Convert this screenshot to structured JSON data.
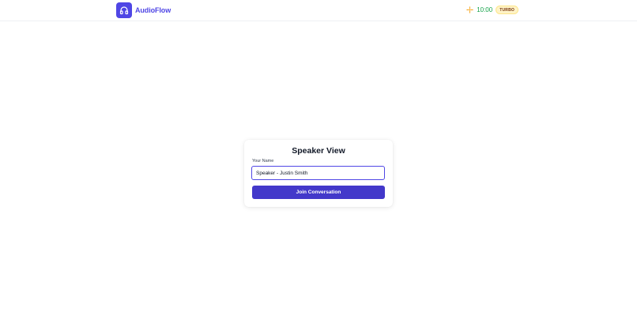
{
  "header": {
    "brand_name": "AudioFlow",
    "logo_icon": "headphones-icon",
    "status_icon": "sparkle-icon",
    "timer": "10:00",
    "mode_badge": "TURBO"
  },
  "card": {
    "title": "Speaker View",
    "name_label": "Your Name",
    "name_value": "Speaker - Justin Smith",
    "join_button_label": "Join Conversation"
  },
  "colors": {
    "brand": "#4f46e5",
    "button": "#4338ca",
    "timer": "#16a34a",
    "status_icon": "#f59e0b",
    "badge_bg": "#fef3c7"
  }
}
